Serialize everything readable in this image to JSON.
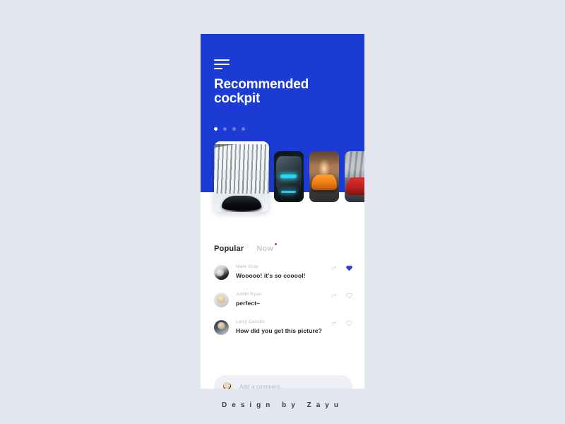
{
  "page": {
    "background_color": "#e4e7f0",
    "footer_credit": "Design by Zayu"
  },
  "phone": {
    "background_color": "#ffffff",
    "hero": {
      "background_color": "#1c3ad4",
      "menu_icon": "hamburger-menu-icon",
      "title": "Recommended\ncockpit",
      "pagination": {
        "count": 4,
        "active_index": 0,
        "active_color": "#ffffff",
        "inactive_color": "rgba(255,255,255,0.35)"
      }
    },
    "carousel": {
      "main_card": {
        "name": "snowy-forest-black-sports-car",
        "alt": "Black sports car parked on snow in a winter forest"
      },
      "thumbnails": [
        {
          "name": "dark-car-cyan-headlight",
          "alt": "Dark car front with glowing cyan headlight"
        },
        {
          "name": "orange-sports-car",
          "alt": "Orange sports car under a concrete overpass"
        },
        {
          "name": "red-sports-car",
          "alt": "Red sports car on a gravel road"
        }
      ]
    },
    "tabs": [
      {
        "label": "Popular",
        "active": true,
        "badge": false
      },
      {
        "label": "Now",
        "active": false,
        "badge": true,
        "badge_color": "#ef3124"
      }
    ],
    "comments": [
      {
        "avatar": "avatar-mark-gray",
        "name": "Mark Gray",
        "text": "Wooooo!  it's so cooool!",
        "reply_icon": "reply-icon",
        "like_icon": "heart-icon",
        "liked": true,
        "like_color": "#2a46d8"
      },
      {
        "avatar": "avatar-judith-ryan",
        "name": "Judith Ryan",
        "text": "perfect~",
        "reply_icon": "reply-icon",
        "like_icon": "heart-icon",
        "liked": false,
        "like_color": "#cfd2d9"
      },
      {
        "avatar": "avatar-larry-castillo",
        "name": "Larry Castillo",
        "text": "How did you get this picture?",
        "reply_icon": "reply-icon",
        "like_icon": "heart-icon",
        "liked": false,
        "like_color": "#cfd2d9"
      }
    ],
    "comment_input": {
      "avatar": "avatar-current-user",
      "placeholder": "Add a comment...",
      "value": "",
      "background_color": "#eef0f6"
    }
  }
}
